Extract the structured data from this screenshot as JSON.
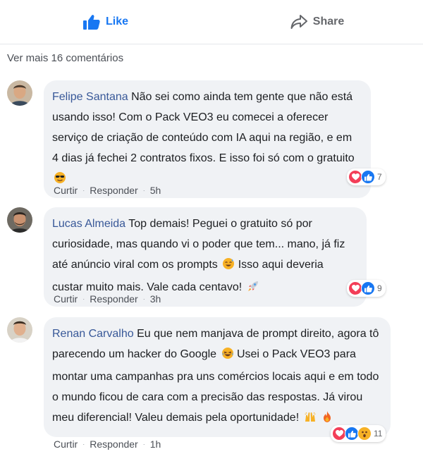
{
  "actions": {
    "like_label": "Like",
    "share_label": "Share"
  },
  "more_comments": "Ver mais 16 comentários",
  "comments": [
    {
      "author": "Felipe Santana",
      "text": "Não sei como ainda tem gente que não está usando isso! Com o Pack VEO3 eu comecei a oferecer serviço de criação de conteúdo com IA aqui na região, e em 4 dias já fechei 2 contratos fixos. E isso foi só com o gratuito",
      "emojis": [
        "sunglasses-face"
      ],
      "reactions": [
        "love",
        "like"
      ],
      "reaction_count": "7",
      "reply_label": "Curtir",
      "respond_label": "Responder",
      "time": "5h"
    },
    {
      "author": "Lucas Almeida",
      "text_a": "Top demais! Peguei o gratuito só por curiosidade, mas quando vi o poder que tem... mano, já fiz até anúncio viral com os prompts",
      "text_b": "Isso aqui deveria custar muito mais. Vale cada centavo!",
      "emojis": [
        "sweat-smile-face",
        "rocket"
      ],
      "reactions": [
        "love",
        "like"
      ],
      "reaction_count": "9",
      "reply_label": "Curtir",
      "respond_label": "Responder",
      "time": "3h"
    },
    {
      "author": "Renan Carvalho",
      "text_a": "Eu que nem manjava de prompt direito, agora tô parecendo um hacker do Google",
      "text_b": "Usei o Pack VEO3 para montar uma campanhas pra uns comércios locais aqui e em todo o mundo ficou de cara com a precisão das respostas. Já virou meu diferencial! Valeu demais pela oportunidade!",
      "emojis": [
        "laughing-face",
        "raised-hands",
        "fire"
      ],
      "reactions": [
        "love",
        "like",
        "wow"
      ],
      "reaction_count": "11",
      "reply_label": "Curtir",
      "respond_label": "Responder",
      "time": "1h"
    }
  ],
  "colors": {
    "link": "#385898",
    "like": "#1877f2",
    "bubble": "#f0f2f5"
  }
}
